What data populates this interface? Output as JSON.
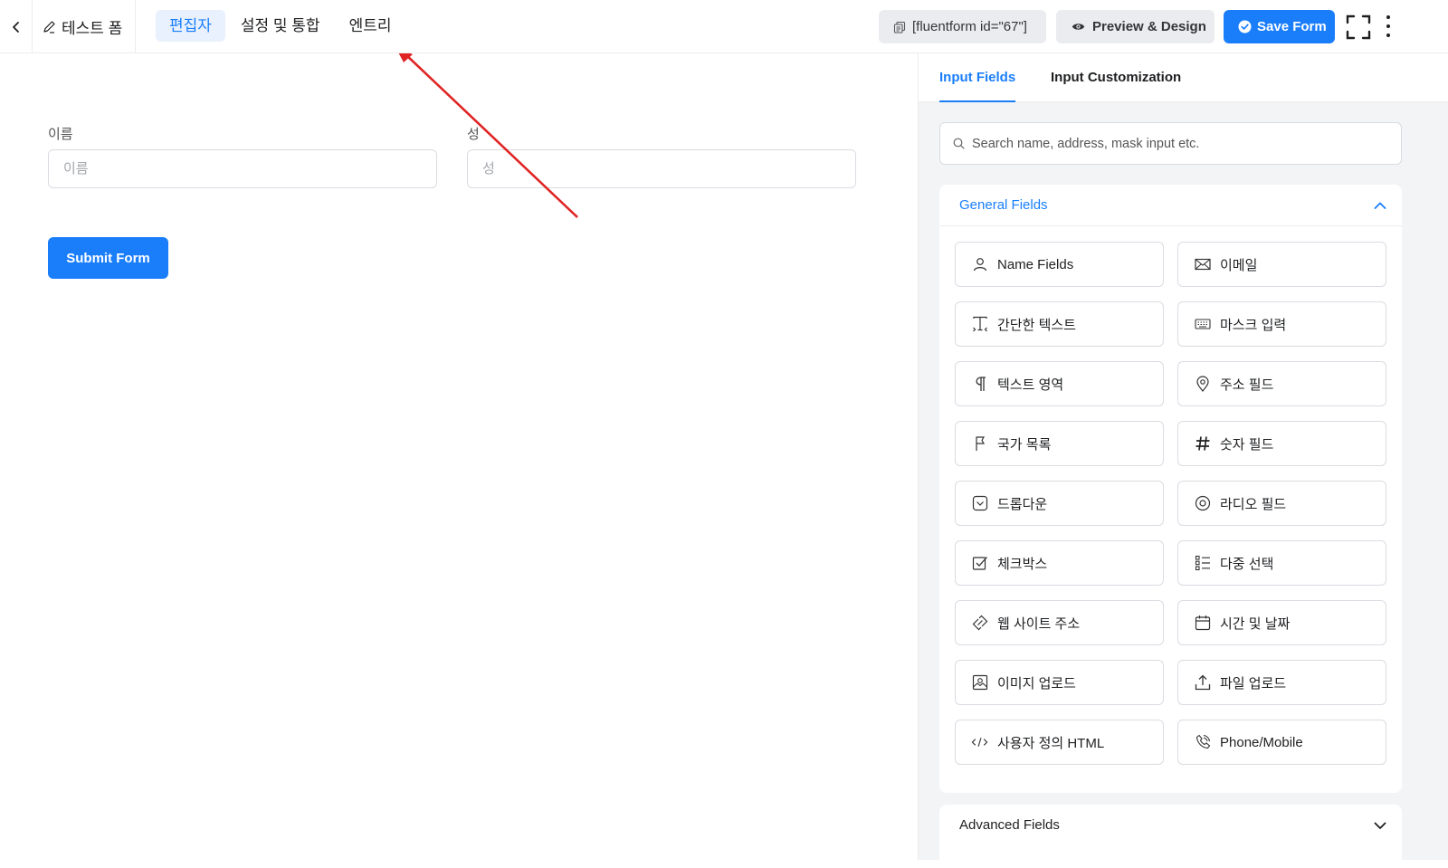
{
  "header": {
    "form_title": "테스트 폼",
    "tabs": [
      {
        "label": "편집자",
        "active": true
      },
      {
        "label": "설정 및 통합",
        "active": false
      },
      {
        "label": "엔트리",
        "active": false
      }
    ],
    "shortcode": "[fluentform id=\"67\"]",
    "preview_label": "Preview & Design",
    "save_label": "Save Form"
  },
  "form": {
    "fields": [
      {
        "label": "이름",
        "placeholder": "이름"
      },
      {
        "label": "성",
        "placeholder": "성"
      }
    ],
    "submit_label": "Submit Form"
  },
  "sidebar": {
    "tabs": [
      {
        "label": "Input Fields",
        "active": true
      },
      {
        "label": "Input Customization",
        "active": false
      }
    ],
    "search_placeholder": "Search name, address, mask input etc.",
    "general_title": "General Fields",
    "general_fields": [
      {
        "label": "Name Fields",
        "icon": "user-icon"
      },
      {
        "label": "이메일",
        "icon": "envelope-icon"
      },
      {
        "label": "간단한 텍스트",
        "icon": "text-cursor-icon"
      },
      {
        "label": "마스크 입력",
        "icon": "keyboard-icon"
      },
      {
        "label": "텍스트 영역",
        "icon": "paragraph-icon"
      },
      {
        "label": "주소 필드",
        "icon": "map-pin-icon"
      },
      {
        "label": "국가 목록",
        "icon": "flag-icon"
      },
      {
        "label": "숫자 필드",
        "icon": "hash-icon"
      },
      {
        "label": "드롭다운",
        "icon": "dropdown-icon"
      },
      {
        "label": "라디오 필드",
        "icon": "radio-icon"
      },
      {
        "label": "체크박스",
        "icon": "checkbox-icon"
      },
      {
        "label": "다중 선택",
        "icon": "list-icon"
      },
      {
        "label": "웹 사이트 주소",
        "icon": "link-icon"
      },
      {
        "label": "시간 및 날짜",
        "icon": "calendar-icon"
      },
      {
        "label": "이미지 업로드",
        "icon": "image-icon"
      },
      {
        "label": "파일 업로드",
        "icon": "upload-icon"
      },
      {
        "label": "사용자 정의 HTML",
        "icon": "code-icon"
      },
      {
        "label": "Phone/Mobile",
        "icon": "phone-icon"
      }
    ],
    "advanced_title": "Advanced Fields"
  },
  "colors": {
    "accent": "#1a7efb",
    "annotation_arrow": "#e02424"
  }
}
